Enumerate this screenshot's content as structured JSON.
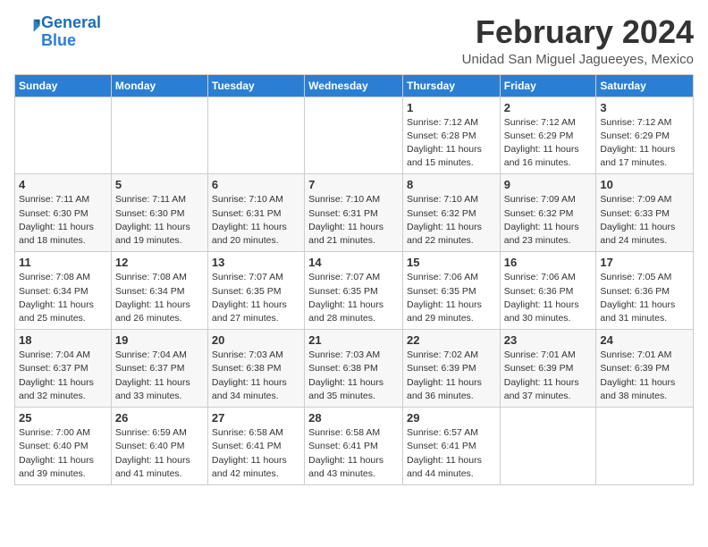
{
  "header": {
    "logo_line1": "General",
    "logo_line2": "Blue",
    "month": "February 2024",
    "location": "Unidad San Miguel Jagueeyes, Mexico"
  },
  "weekdays": [
    "Sunday",
    "Monday",
    "Tuesday",
    "Wednesday",
    "Thursday",
    "Friday",
    "Saturday"
  ],
  "weeks": [
    [
      {
        "day": "",
        "info": ""
      },
      {
        "day": "",
        "info": ""
      },
      {
        "day": "",
        "info": ""
      },
      {
        "day": "",
        "info": ""
      },
      {
        "day": "1",
        "info": "Sunrise: 7:12 AM\nSunset: 6:28 PM\nDaylight: 11 hours\nand 15 minutes."
      },
      {
        "day": "2",
        "info": "Sunrise: 7:12 AM\nSunset: 6:29 PM\nDaylight: 11 hours\nand 16 minutes."
      },
      {
        "day": "3",
        "info": "Sunrise: 7:12 AM\nSunset: 6:29 PM\nDaylight: 11 hours\nand 17 minutes."
      }
    ],
    [
      {
        "day": "4",
        "info": "Sunrise: 7:11 AM\nSunset: 6:30 PM\nDaylight: 11 hours\nand 18 minutes."
      },
      {
        "day": "5",
        "info": "Sunrise: 7:11 AM\nSunset: 6:30 PM\nDaylight: 11 hours\nand 19 minutes."
      },
      {
        "day": "6",
        "info": "Sunrise: 7:10 AM\nSunset: 6:31 PM\nDaylight: 11 hours\nand 20 minutes."
      },
      {
        "day": "7",
        "info": "Sunrise: 7:10 AM\nSunset: 6:31 PM\nDaylight: 11 hours\nand 21 minutes."
      },
      {
        "day": "8",
        "info": "Sunrise: 7:10 AM\nSunset: 6:32 PM\nDaylight: 11 hours\nand 22 minutes."
      },
      {
        "day": "9",
        "info": "Sunrise: 7:09 AM\nSunset: 6:32 PM\nDaylight: 11 hours\nand 23 minutes."
      },
      {
        "day": "10",
        "info": "Sunrise: 7:09 AM\nSunset: 6:33 PM\nDaylight: 11 hours\nand 24 minutes."
      }
    ],
    [
      {
        "day": "11",
        "info": "Sunrise: 7:08 AM\nSunset: 6:34 PM\nDaylight: 11 hours\nand 25 minutes."
      },
      {
        "day": "12",
        "info": "Sunrise: 7:08 AM\nSunset: 6:34 PM\nDaylight: 11 hours\nand 26 minutes."
      },
      {
        "day": "13",
        "info": "Sunrise: 7:07 AM\nSunset: 6:35 PM\nDaylight: 11 hours\nand 27 minutes."
      },
      {
        "day": "14",
        "info": "Sunrise: 7:07 AM\nSunset: 6:35 PM\nDaylight: 11 hours\nand 28 minutes."
      },
      {
        "day": "15",
        "info": "Sunrise: 7:06 AM\nSunset: 6:35 PM\nDaylight: 11 hours\nand 29 minutes."
      },
      {
        "day": "16",
        "info": "Sunrise: 7:06 AM\nSunset: 6:36 PM\nDaylight: 11 hours\nand 30 minutes."
      },
      {
        "day": "17",
        "info": "Sunrise: 7:05 AM\nSunset: 6:36 PM\nDaylight: 11 hours\nand 31 minutes."
      }
    ],
    [
      {
        "day": "18",
        "info": "Sunrise: 7:04 AM\nSunset: 6:37 PM\nDaylight: 11 hours\nand 32 minutes."
      },
      {
        "day": "19",
        "info": "Sunrise: 7:04 AM\nSunset: 6:37 PM\nDaylight: 11 hours\nand 33 minutes."
      },
      {
        "day": "20",
        "info": "Sunrise: 7:03 AM\nSunset: 6:38 PM\nDaylight: 11 hours\nand 34 minutes."
      },
      {
        "day": "21",
        "info": "Sunrise: 7:03 AM\nSunset: 6:38 PM\nDaylight: 11 hours\nand 35 minutes."
      },
      {
        "day": "22",
        "info": "Sunrise: 7:02 AM\nSunset: 6:39 PM\nDaylight: 11 hours\nand 36 minutes."
      },
      {
        "day": "23",
        "info": "Sunrise: 7:01 AM\nSunset: 6:39 PM\nDaylight: 11 hours\nand 37 minutes."
      },
      {
        "day": "24",
        "info": "Sunrise: 7:01 AM\nSunset: 6:39 PM\nDaylight: 11 hours\nand 38 minutes."
      }
    ],
    [
      {
        "day": "25",
        "info": "Sunrise: 7:00 AM\nSunset: 6:40 PM\nDaylight: 11 hours\nand 39 minutes."
      },
      {
        "day": "26",
        "info": "Sunrise: 6:59 AM\nSunset: 6:40 PM\nDaylight: 11 hours\nand 41 minutes."
      },
      {
        "day": "27",
        "info": "Sunrise: 6:58 AM\nSunset: 6:41 PM\nDaylight: 11 hours\nand 42 minutes."
      },
      {
        "day": "28",
        "info": "Sunrise: 6:58 AM\nSunset: 6:41 PM\nDaylight: 11 hours\nand 43 minutes."
      },
      {
        "day": "29",
        "info": "Sunrise: 6:57 AM\nSunset: 6:41 PM\nDaylight: 11 hours\nand 44 minutes."
      },
      {
        "day": "",
        "info": ""
      },
      {
        "day": "",
        "info": ""
      }
    ]
  ]
}
